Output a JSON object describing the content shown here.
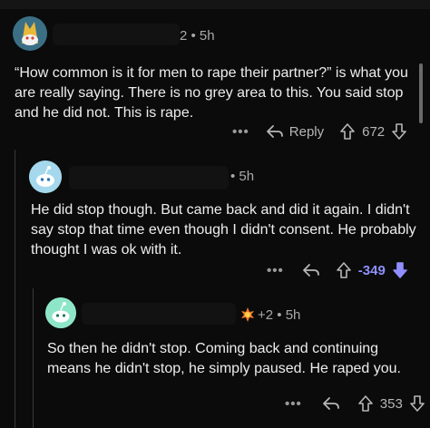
{
  "comments": [
    {
      "time": "2 • 5h",
      "body": "“How common is it for men to rape their partner?” is what you are really saying. There is no grey area to this. You said stop and he did not. This is rape.",
      "more": "•••",
      "reply_label": "Reply",
      "score": "672"
    },
    {
      "time": "• 5h",
      "body": "He did stop though. But came back and did it again. I didn't say stop that time even though I didn't consent. He probably thought I was ok with it.",
      "more": "•••",
      "score": "-349"
    },
    {
      "time": "+2 • 5h",
      "body": "So then he didn't stop. Coming back and continuing means he didn't stop, he simply paused. He raped you.",
      "more": "•••",
      "score": "353"
    }
  ],
  "colors": {
    "background": "#0b0b0b",
    "text": "#ededed",
    "meta": "#a9a9a9",
    "downvoted": "#8f8fff"
  },
  "icons": [
    "avatar-snoo-trophy-icon",
    "avatar-snoo-blue-icon",
    "avatar-snoo-green-icon",
    "award-icon",
    "reply-arrow-icon",
    "upvote-icon",
    "downvote-icon",
    "more-options-icon"
  ]
}
